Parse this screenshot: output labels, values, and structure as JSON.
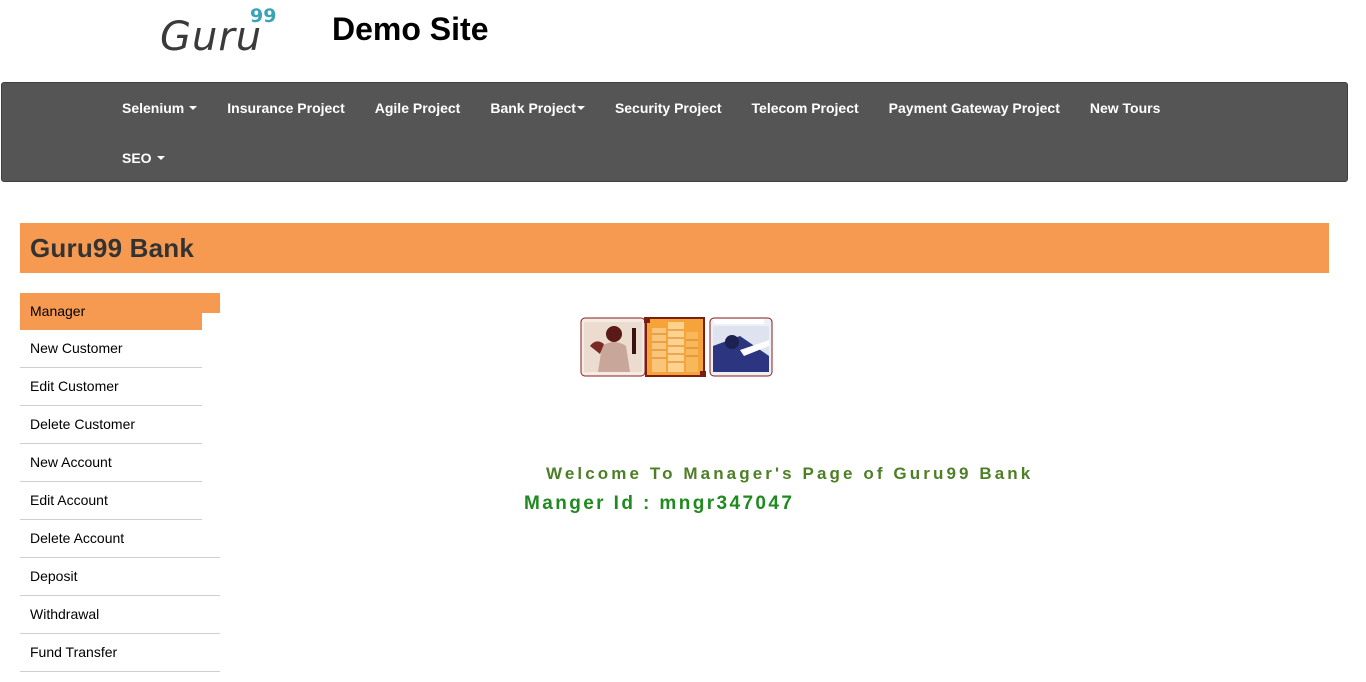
{
  "header": {
    "logo_text": "Guru",
    "logo_superscript": "99",
    "site_title": "Demo Site"
  },
  "navbar": {
    "items": [
      {
        "label": "Selenium",
        "dropdown": true
      },
      {
        "label": "Insurance Project",
        "dropdown": false
      },
      {
        "label": "Agile Project",
        "dropdown": false
      },
      {
        "label": "Bank Project",
        "dropdown": true
      },
      {
        "label": "Security Project",
        "dropdown": false
      },
      {
        "label": "Telecom Project",
        "dropdown": false
      },
      {
        "label": "Payment Gateway Project",
        "dropdown": false
      },
      {
        "label": "New Tours",
        "dropdown": false
      },
      {
        "label": "SEO",
        "dropdown": true
      }
    ]
  },
  "bank": {
    "title": "Guru99 Bank"
  },
  "sidebar": {
    "items": [
      {
        "label": "Manager",
        "active": true
      },
      {
        "label": "New Customer"
      },
      {
        "label": "Edit Customer"
      },
      {
        "label": "Delete Customer"
      },
      {
        "label": "New Account"
      },
      {
        "label": "Edit Account"
      },
      {
        "label": "Delete Account"
      },
      {
        "label": "Deposit"
      },
      {
        "label": "Withdrawal"
      },
      {
        "label": "Fund Transfer"
      }
    ]
  },
  "main": {
    "welcome_text": "Welcome To Manager's Page of Guru99 Bank",
    "manager_id_text": "Manger Id : mngr347047"
  },
  "colors": {
    "navbar_bg": "#555555",
    "accent_orange": "#f79a51",
    "welcome_green": "#4d7f26",
    "id_green": "#1f8a1f",
    "logo_teal": "#3ba3b8"
  }
}
